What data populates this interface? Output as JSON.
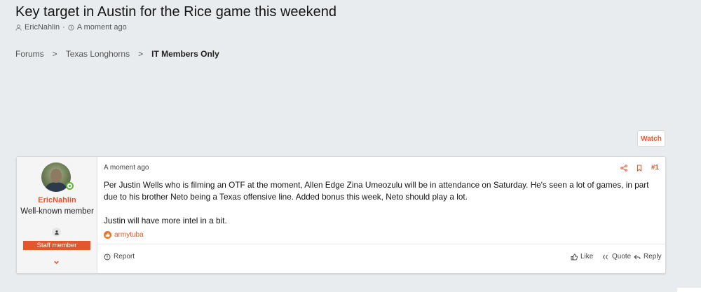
{
  "thread": {
    "title": "Key target in Austin for the Rice game this weekend",
    "author": "EricNahlin",
    "separator": "·",
    "time": "A moment ago"
  },
  "breadcrumb": {
    "items": [
      "Forums",
      "Texas Longhorns",
      "IT Members Only"
    ],
    "separator": ">"
  },
  "watch_button": "Watch",
  "post": {
    "user": {
      "name": "EricNahlin",
      "title": "Well-known member",
      "badge": "Staff member"
    },
    "date": "A moment ago",
    "number": "#1",
    "body": [
      "Per Justin Wells who is filming an OTF at the moment, Allen Edge Zina Umeozulu will be in attendance on Saturday. He's seen a lot of games, in part due to his brother Neto being a Texas offensive line. Added bonus this week, Neto should play a lot.",
      "Justin will have more intel in a bit."
    ],
    "reaction_user": "armytuba",
    "footer": {
      "report": "Report",
      "like": "Like",
      "quote": "Quote",
      "reply": "Reply"
    }
  },
  "colors": {
    "accent": "#e4572e",
    "background": "#e9ecef",
    "online": "#63b13b"
  }
}
